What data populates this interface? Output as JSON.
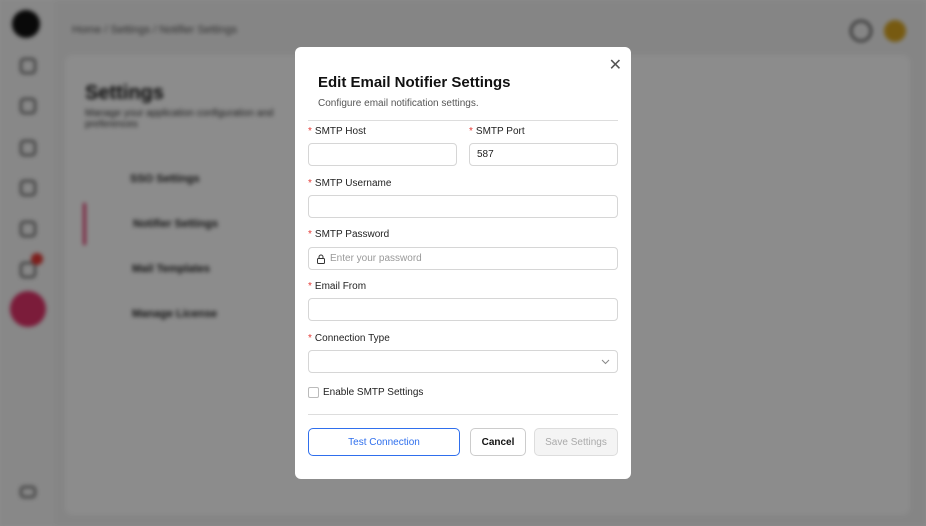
{
  "background": {
    "breadcrumb": "Home / Settings / Notifier Settings",
    "title": "Settings",
    "subtitle": "Manage your application configuration and preferences",
    "nav": [
      {
        "label": "SSO Settings"
      },
      {
        "label": "Notifier Settings"
      },
      {
        "label": "Mail Templates"
      },
      {
        "label": "Manage License"
      }
    ],
    "accent": "#e0336a"
  },
  "modal": {
    "title": "Edit Email Notifier Settings",
    "description": "Configure email notification settings.",
    "required_mark": "*",
    "fields": {
      "smtp_host": {
        "label": "SMTP Host",
        "value": ""
      },
      "smtp_port": {
        "label": "SMTP Port",
        "value": "587"
      },
      "smtp_username": {
        "label": "SMTP Username",
        "value": ""
      },
      "smtp_password": {
        "label": "SMTP Password",
        "placeholder": "Enter your password"
      },
      "email_from": {
        "label": "Email From",
        "value": ""
      },
      "connection_type": {
        "label": "Connection Type",
        "value": ""
      }
    },
    "enable_smtp": {
      "label": "Enable SMTP Settings",
      "checked": false
    },
    "buttons": {
      "test": "Test Connection",
      "cancel": "Cancel",
      "save": "Save Settings"
    },
    "colors": {
      "primary": "#2f6fed",
      "required": "#e53935"
    }
  }
}
